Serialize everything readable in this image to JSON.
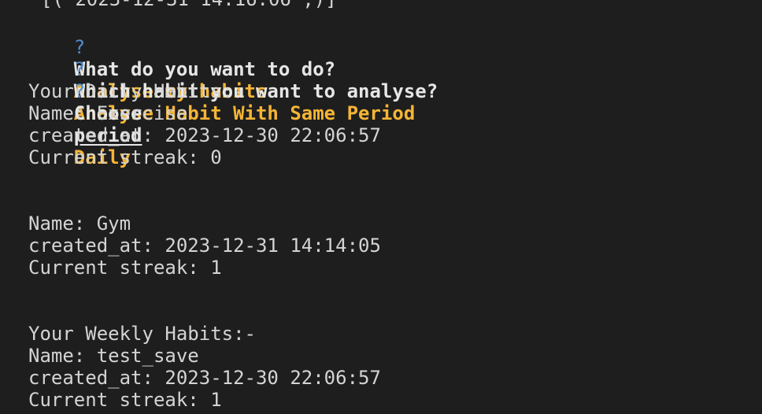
{
  "colors": {
    "background": "#1e1e1e",
    "text": "#d4d4d4",
    "prompt_question_mark": "#4e8fce",
    "answer": "#f5b536"
  },
  "top_partial_line": "[('2023-12-31 14:16:06',)]",
  "prompts": [
    {
      "mark": "?",
      "question": "What do you want to do?",
      "answer": "Analyse my habits"
    },
    {
      "mark": "?",
      "question": "Which habit you want to analyse?",
      "answer": "Analyse Habit With Same Period"
    },
    {
      "mark": "?",
      "question_prefix": "Choose",
      "question_underlined": "period",
      "answer": "Daily"
    }
  ],
  "daily": {
    "heading": "Your Daily Habits:-",
    "habits": [
      {
        "name": "Name: Exercise",
        "created": "created_at: 2023-12-30 22:06:57",
        "streak": "Current streak: 0"
      },
      {
        "name": "Name: Gym",
        "created": "created_at: 2023-12-31 14:14:05",
        "streak": "Current streak: 1"
      }
    ]
  },
  "weekly": {
    "heading": "Your Weekly Habits:-",
    "habits": [
      {
        "name": "Name: test_save",
        "created": "created_at: 2023-12-30 22:06:57",
        "streak": "Current streak: 1"
      }
    ]
  }
}
